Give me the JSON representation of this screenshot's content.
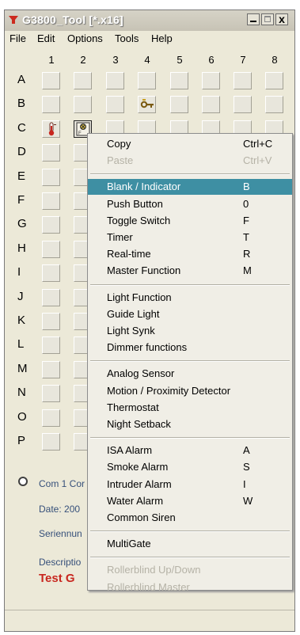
{
  "window": {
    "title": "G3800_Tool [*.x16]",
    "close_glyph": "x"
  },
  "menubar": [
    "File",
    "Edit",
    "Options",
    "Tools",
    "Help"
  ],
  "grid": {
    "columns": [
      "1",
      "2",
      "3",
      "4",
      "5",
      "6",
      "7",
      "8"
    ],
    "rows": [
      "A",
      "B",
      "C",
      "D",
      "E",
      "F",
      "G",
      "H",
      "I",
      "J",
      "K",
      "L",
      "M",
      "N",
      "O",
      "P"
    ],
    "icons": [
      {
        "row": "B",
        "column": "4",
        "icon": "key-icon"
      },
      {
        "row": "C",
        "column": "1",
        "icon": "thermometer-icon"
      },
      {
        "row": "C",
        "column": "2",
        "icon": "smoke-detector-icon"
      }
    ]
  },
  "info": {
    "com": "Com 1 Cor",
    "date": "Date: 200",
    "serial": "Seriennun",
    "description_label": "Descriptio",
    "description_value": "Test G"
  },
  "context_menu": {
    "groups": [
      [
        {
          "label": "Copy",
          "shortcut": "Ctrl+C",
          "enabled": true
        },
        {
          "label": "Paste",
          "shortcut": "Ctrl+V",
          "enabled": false
        }
      ],
      [
        {
          "label": "Blank / Indicator",
          "shortcut": "B",
          "enabled": true,
          "highlighted": true
        },
        {
          "label": "Push Button",
          "shortcut": "0",
          "enabled": true
        },
        {
          "label": "Toggle Switch",
          "shortcut": "F",
          "enabled": true
        },
        {
          "label": "Timer",
          "shortcut": "T",
          "enabled": true
        },
        {
          "label": "Real-time",
          "shortcut": "R",
          "enabled": true
        },
        {
          "label": "Master Function",
          "shortcut": "M",
          "enabled": true
        }
      ],
      [
        {
          "label": "Light Function",
          "shortcut": "",
          "enabled": true
        },
        {
          "label": "Guide Light",
          "shortcut": "",
          "enabled": true
        },
        {
          "label": "Light Synk",
          "shortcut": "",
          "enabled": true
        },
        {
          "label": "Dimmer functions",
          "shortcut": "",
          "enabled": true
        }
      ],
      [
        {
          "label": "Analog Sensor",
          "shortcut": "",
          "enabled": true
        },
        {
          "label": "Motion / Proximity Detector",
          "shortcut": "",
          "enabled": true
        },
        {
          "label": "Thermostat",
          "shortcut": "",
          "enabled": true
        },
        {
          "label": "Night Setback",
          "shortcut": "",
          "enabled": true
        }
      ],
      [
        {
          "label": "ISA Alarm",
          "shortcut": "A",
          "enabled": true
        },
        {
          "label": "Smoke Alarm",
          "shortcut": "S",
          "enabled": true
        },
        {
          "label": "Intruder Alarm",
          "shortcut": "I",
          "enabled": true
        },
        {
          "label": "Water Alarm",
          "shortcut": "W",
          "enabled": true
        },
        {
          "label": "Common Siren",
          "shortcut": "",
          "enabled": true
        }
      ],
      [
        {
          "label": "MultiGate",
          "shortcut": "",
          "enabled": true
        }
      ],
      [
        {
          "label": "Rollerblind Up/Down",
          "shortcut": "",
          "enabled": false
        },
        {
          "label": "Rollerblind Master",
          "shortcut": "",
          "enabled": false
        }
      ]
    ]
  },
  "colors": {
    "highlight": "#3e8fa3",
    "description_value": "#c8271f",
    "info_text": "#36507a"
  }
}
